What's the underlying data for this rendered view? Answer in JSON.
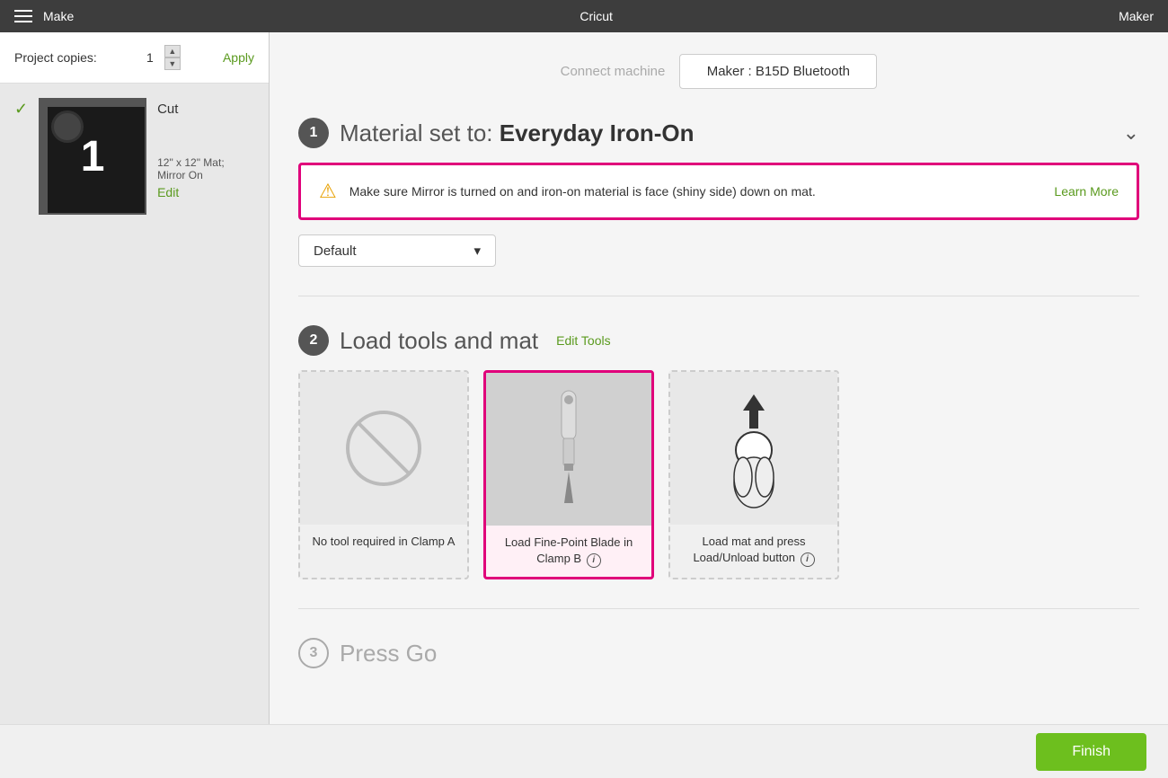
{
  "topbar": {
    "menu_icon": "hamburger",
    "title": "Make",
    "brand": "Cricut",
    "machine": "Maker"
  },
  "left_panel": {
    "project_copies_label": "Project copies:",
    "copies_value": "1",
    "apply_label": "Apply",
    "mat_number": "1",
    "cut_label": "Cut",
    "mat_size_label": "12\" x 12\" Mat; Mirror On",
    "edit_label": "Edit"
  },
  "connect_bar": {
    "connect_text": "Connect machine",
    "machine_btn_label": "Maker : B15D Bluetooth"
  },
  "step1": {
    "number": "1",
    "title_pre": "Material set to:",
    "title_bold": "Everyday Iron-On",
    "warning_text": "Make sure Mirror is turned on and iron-on material is face (shiny side) down on mat.",
    "learn_more": "Learn More",
    "dropdown_label": "Default",
    "dropdown_arrow": "▾"
  },
  "step2": {
    "number": "2",
    "title": "Load tools and mat",
    "edit_tools_label": "Edit Tools",
    "cards": [
      {
        "id": "clamp-a",
        "label": "No tool required in Clamp A",
        "type": "no-tool",
        "highlighted": false
      },
      {
        "id": "clamp-b",
        "label": "Load Fine-Point Blade in Clamp B",
        "type": "blade",
        "highlighted": true,
        "info": true
      },
      {
        "id": "mat-load",
        "label": "Load mat and press Load/Unload button",
        "type": "mat",
        "highlighted": false,
        "info": true
      }
    ]
  },
  "step3": {
    "number": "3",
    "title": "Press Go"
  },
  "footer": {
    "finish_label": "Finish"
  }
}
